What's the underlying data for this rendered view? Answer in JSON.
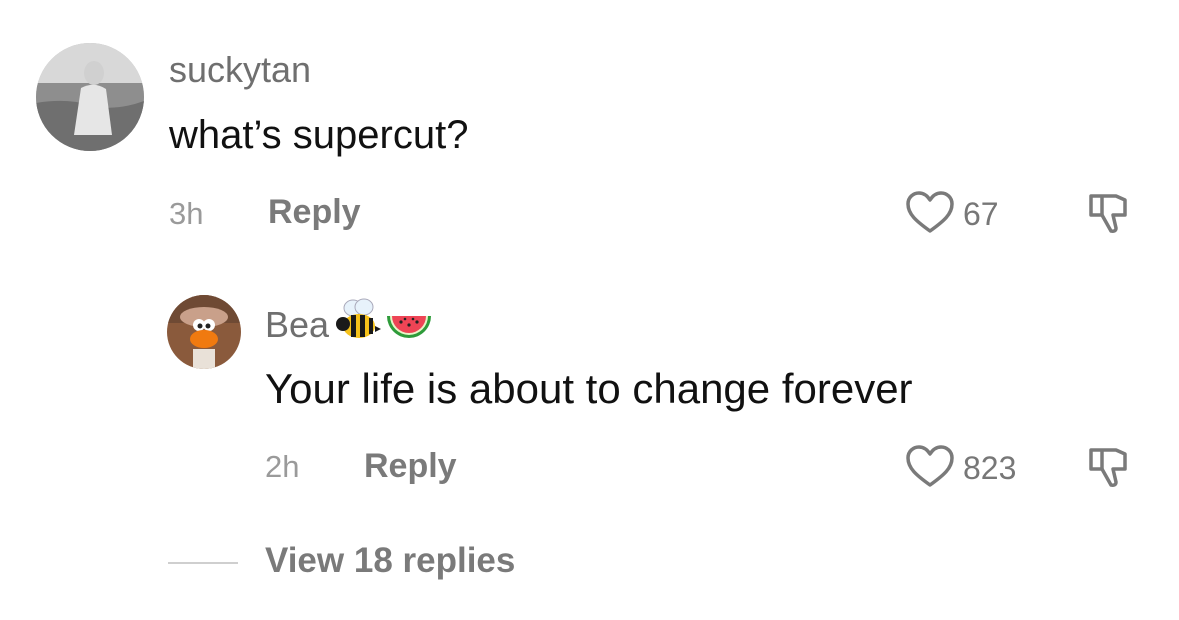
{
  "comments": [
    {
      "username": "suckytan",
      "text": "what’s supercut?",
      "time": "3h",
      "reply_label": "Reply",
      "likes": "67"
    },
    {
      "username": "Bea",
      "username_emoji": [
        "bee-emoji",
        "watermelon-emoji"
      ],
      "text": "Your life is about to change forever",
      "time": "2h",
      "reply_label": "Reply",
      "likes": "823"
    }
  ],
  "view_replies_label": "View 18 replies",
  "colors": {
    "username": "#6f6f6f",
    "text": "#111111",
    "meta": "#9a9a9a",
    "action": "#7a7a7a"
  }
}
